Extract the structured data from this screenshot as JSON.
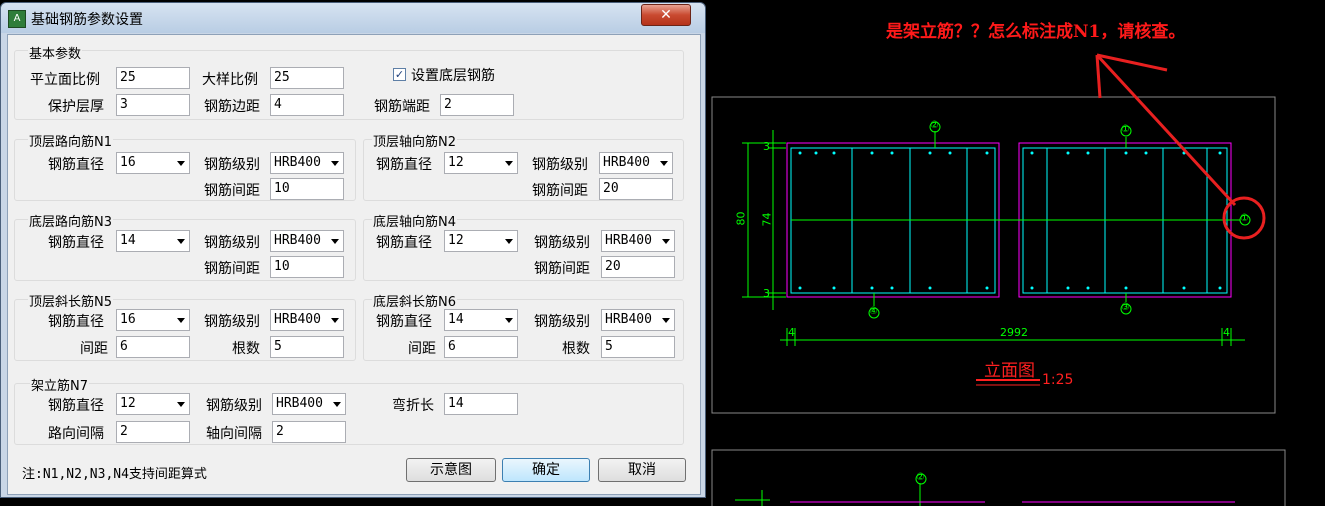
{
  "window": {
    "title": "基础钢筋参数设置",
    "close_label": "✕"
  },
  "basic": {
    "group_label": "基本参数",
    "plane_scale_label": "平立面比例",
    "plane_scale_value": "25",
    "detail_scale_label": "大样比例",
    "detail_scale_value": "25",
    "set_bottom_label": "设置底层钢筋",
    "set_bottom_checked": "✓",
    "cover_label": "保护层厚",
    "cover_value": "3",
    "edge_dist_label": "钢筋边距",
    "edge_dist_value": "4",
    "end_dist_label": "钢筋端距",
    "end_dist_value": "2"
  },
  "n1": {
    "group_label": "顶层路向筋N1",
    "dia_label": "钢筋直径",
    "dia_value": "16",
    "grade_label": "钢筋级别",
    "grade_value": "HRB400",
    "spacing_label": "钢筋间距",
    "spacing_value": "10"
  },
  "n2": {
    "group_label": "顶层轴向筋N2",
    "dia_label": "钢筋直径",
    "dia_value": "12",
    "grade_label": "钢筋级别",
    "grade_value": "HRB400",
    "spacing_label": "钢筋间距",
    "spacing_value": "20"
  },
  "n3": {
    "group_label": "底层路向筋N3",
    "dia_label": "钢筋直径",
    "dia_value": "14",
    "grade_label": "钢筋级别",
    "grade_value": "HRB400",
    "spacing_label": "钢筋间距",
    "spacing_value": "10"
  },
  "n4": {
    "group_label": "底层轴向筋N4",
    "dia_label": "钢筋直径",
    "dia_value": "12",
    "grade_label": "钢筋级别",
    "grade_value": "HRB400",
    "spacing_label": "钢筋间距",
    "spacing_value": "20"
  },
  "n5": {
    "group_label": "顶层斜长筋N5",
    "dia_label": "钢筋直径",
    "dia_value": "16",
    "grade_label": "钢筋级别",
    "grade_value": "HRB400",
    "spacing_label": "间距",
    "spacing_value": "6",
    "count_label": "根数",
    "count_value": "5"
  },
  "n6": {
    "group_label": "底层斜长筋N6",
    "dia_label": "钢筋直径",
    "dia_value": "14",
    "grade_label": "钢筋级别",
    "grade_value": "HRB400",
    "spacing_label": "间距",
    "spacing_value": "6",
    "count_label": "根数",
    "count_value": "5"
  },
  "n7": {
    "group_label": "架立筋N7",
    "dia_label": "钢筋直径",
    "dia_value": "12",
    "grade_label": "钢筋级别",
    "grade_value": "HRB400",
    "bend_label": "弯折长",
    "bend_value": "14",
    "road_label": "路向间隔",
    "road_value": "2",
    "axis_label": "轴向间隔",
    "axis_value": "2"
  },
  "footer": {
    "note": "注:N1,N2,N3,N4支持间距算式",
    "diagram_label": "示意图",
    "ok_label": "确定",
    "cancel_label": "取消"
  },
  "cad": {
    "annotation": "是架立筋？？怎么标注成N1，请核查。",
    "dim_80": "80",
    "dim_74": "74",
    "dim_3a": "3",
    "dim_3b": "3",
    "dim_2992": "2992",
    "dim_4a": "4",
    "dim_4b": "4",
    "label_2": "②",
    "label_1": "①",
    "label_4": "④",
    "label_3": "③",
    "label_1b": "①",
    "label_2b": "②",
    "elevation_title": "立面图",
    "scale": "1:25"
  },
  "colors": {
    "cad_green": "#00ff00",
    "cad_magenta": "#ff00ff",
    "cad_cyan": "#00ffff",
    "annotation_red": "#ff2020"
  }
}
